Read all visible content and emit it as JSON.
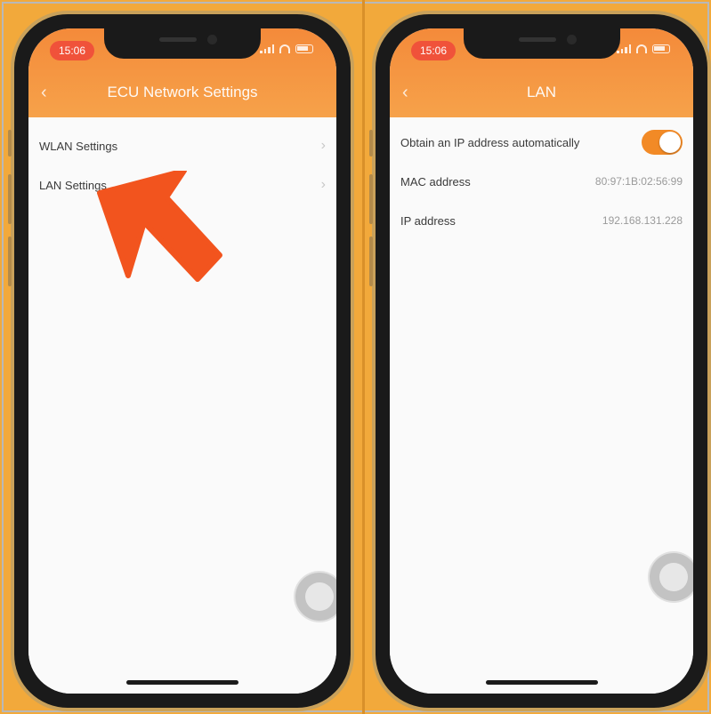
{
  "left_phone": {
    "status": {
      "time": "15:06"
    },
    "header": {
      "title": "ECU Network Settings",
      "back_icon": "chevron-left-icon"
    },
    "menu": [
      {
        "label": "WLAN Settings",
        "icon": "chevron-right-icon"
      },
      {
        "label": "LAN Settings",
        "icon": "chevron-right-icon"
      }
    ],
    "annotation": {
      "icon": "arrow-pointer-icon",
      "color": "#f2541e"
    }
  },
  "right_phone": {
    "status": {
      "time": "15:06"
    },
    "header": {
      "title": "LAN",
      "back_icon": "chevron-left-icon"
    },
    "settings": [
      {
        "label": "Obtain an IP address automatically",
        "toggle_on": true
      },
      {
        "label": "MAC address",
        "value": "80:97:1B:02:56:99"
      },
      {
        "label": "IP address",
        "value": "192.168.131.228"
      }
    ]
  },
  "colors": {
    "header": "#f6a24a",
    "accent": "#f28a26",
    "background": "#f2a93b"
  }
}
